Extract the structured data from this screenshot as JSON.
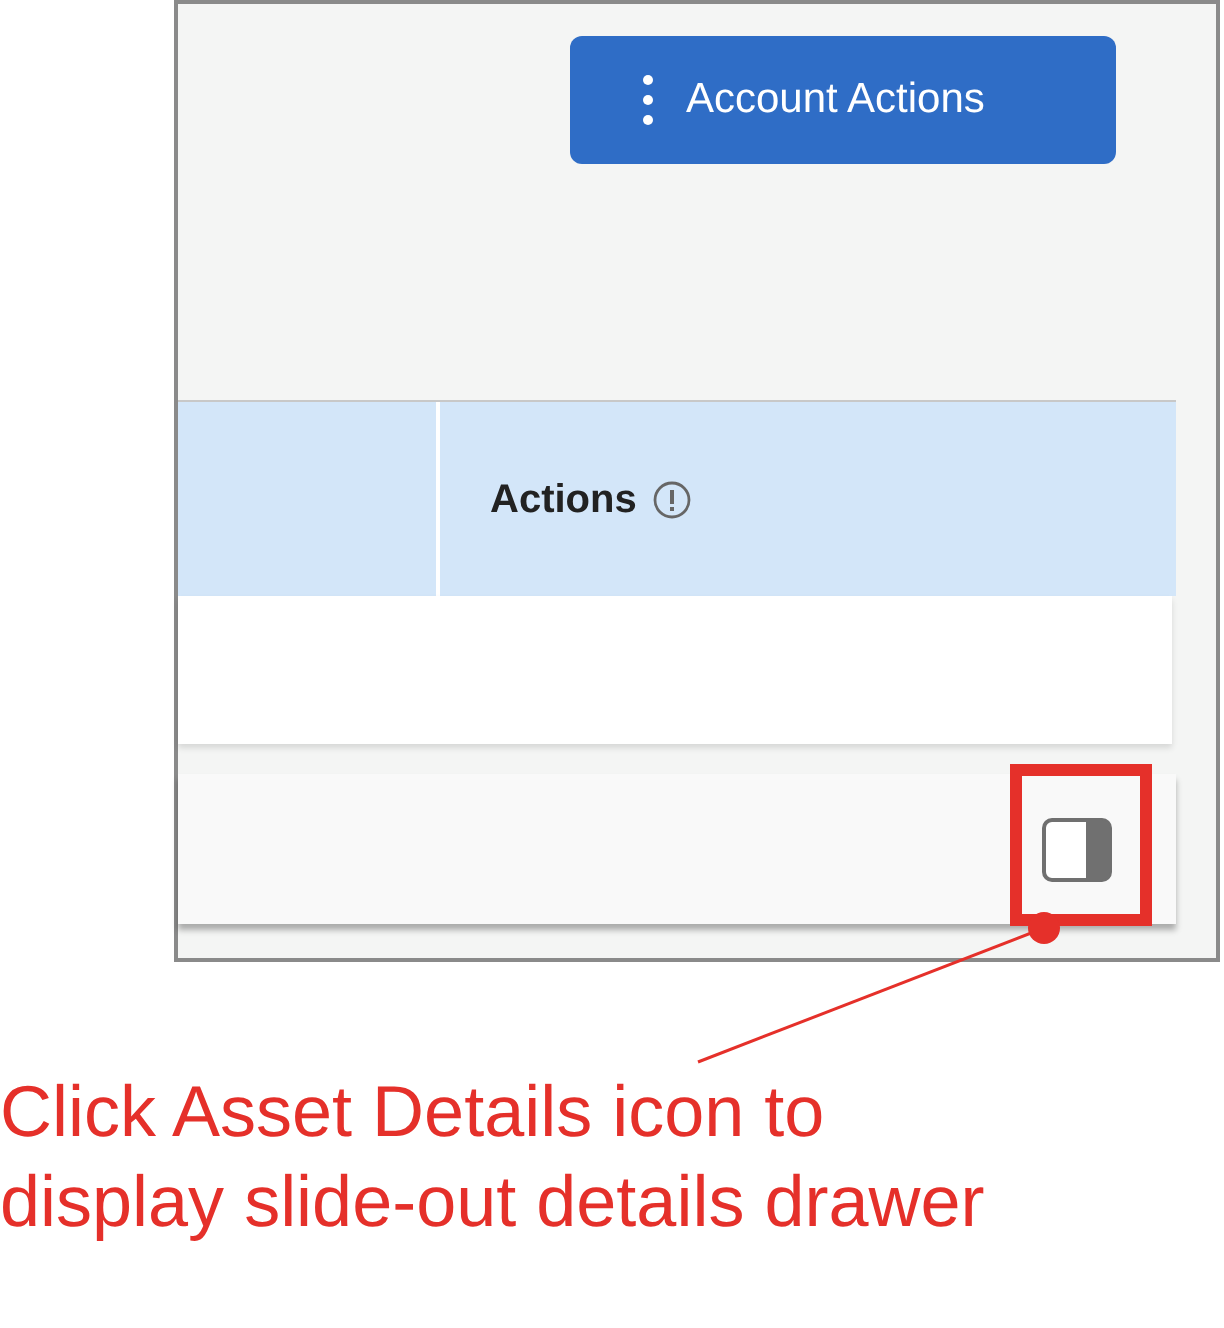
{
  "header": {
    "button": {
      "label": "Account Actions"
    }
  },
  "table": {
    "columns": [
      {
        "label": "Actions"
      }
    ]
  },
  "annotation": {
    "text": "Click Asset Details icon to display slide-out details drawer"
  }
}
